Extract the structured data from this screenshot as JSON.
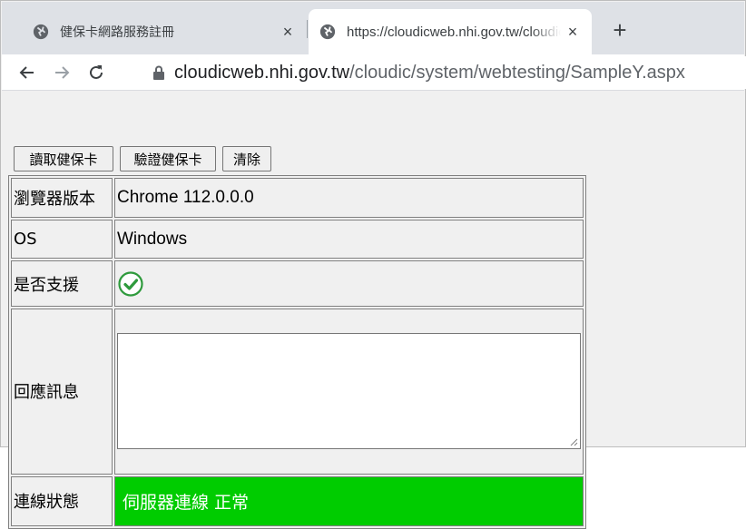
{
  "browser": {
    "tabs": [
      {
        "title": "健保卡網路服務註冊",
        "close": "×"
      },
      {
        "title": "https://cloudicweb.nhi.gov.tw/cloudic/system/webtesting/SampleY.aspx",
        "close": "×"
      }
    ],
    "new_tab": "+",
    "address": {
      "host": "cloudicweb.nhi.gov.tw",
      "path": "/cloudic/system/webtesting/SampleY.aspx"
    }
  },
  "page": {
    "buttons": {
      "read_card": "讀取健保卡",
      "verify_card": "驗證健保卡",
      "clear": "清除"
    },
    "rows": {
      "browser_version": {
        "label": "瀏覽器版本",
        "value": "Chrome 112.0.0.0"
      },
      "os": {
        "label": "OS",
        "value": "Windows"
      },
      "supported": {
        "label": "是否支援",
        "icon": "check-circle-icon"
      },
      "response": {
        "label": "回應訊息",
        "value": ""
      },
      "connection": {
        "label": "連線狀態",
        "value": "伺服器連線 正常"
      }
    },
    "colors": {
      "status_bg": "#00cc00",
      "check_green": "#2e9a3c"
    }
  }
}
